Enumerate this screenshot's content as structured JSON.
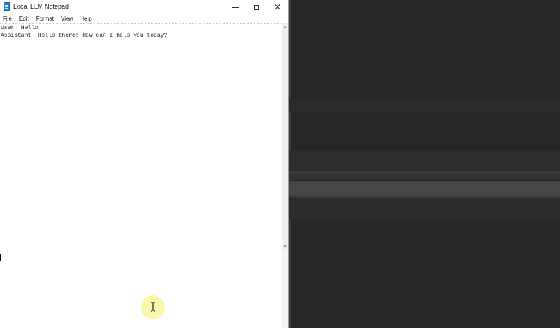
{
  "window": {
    "title": "Local LLM Notepad",
    "icon": "notepad-icon",
    "controls": {
      "minimize": "minimize-icon",
      "maximize": "maximize-icon",
      "close": "close-icon"
    }
  },
  "menubar": {
    "items": [
      "File",
      "Edit",
      "Format",
      "View",
      "Help"
    ]
  },
  "editor": {
    "content": "User: Hello\nAssistant: Hello there! How can I help you today?"
  },
  "cursor": {
    "icon": "text-cursor-icon",
    "highlight_color": "#fbf7a8"
  },
  "colors": {
    "background": "#262626",
    "editor_background": "#ffffff"
  }
}
